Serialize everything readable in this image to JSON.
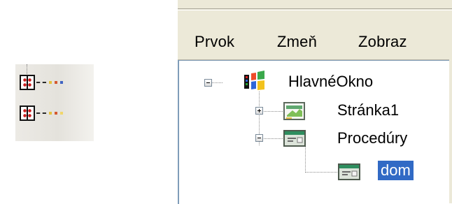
{
  "menu": {
    "items": [
      {
        "label": "Prvok"
      },
      {
        "label": "Zmeň"
      },
      {
        "label": "Zobraz"
      }
    ]
  },
  "tree": {
    "root": {
      "label": "HlavnéOkno",
      "icon": "application-window-icon",
      "expanded": true
    },
    "children": [
      {
        "label": "Stránka1",
        "icon": "page-icon",
        "expanded": false
      },
      {
        "label": "Procedúry",
        "icon": "form-icon",
        "expanded": true,
        "children": [
          {
            "label": "dom",
            "icon": "form-icon",
            "selected": true
          }
        ]
      }
    ]
  },
  "colors": {
    "selection": "#316ac5",
    "frame": "#ece9d8",
    "border": "#7f9db9"
  },
  "icons": [
    "tree-node-icon",
    "expander-minus-icon",
    "expander-plus-icon"
  ]
}
